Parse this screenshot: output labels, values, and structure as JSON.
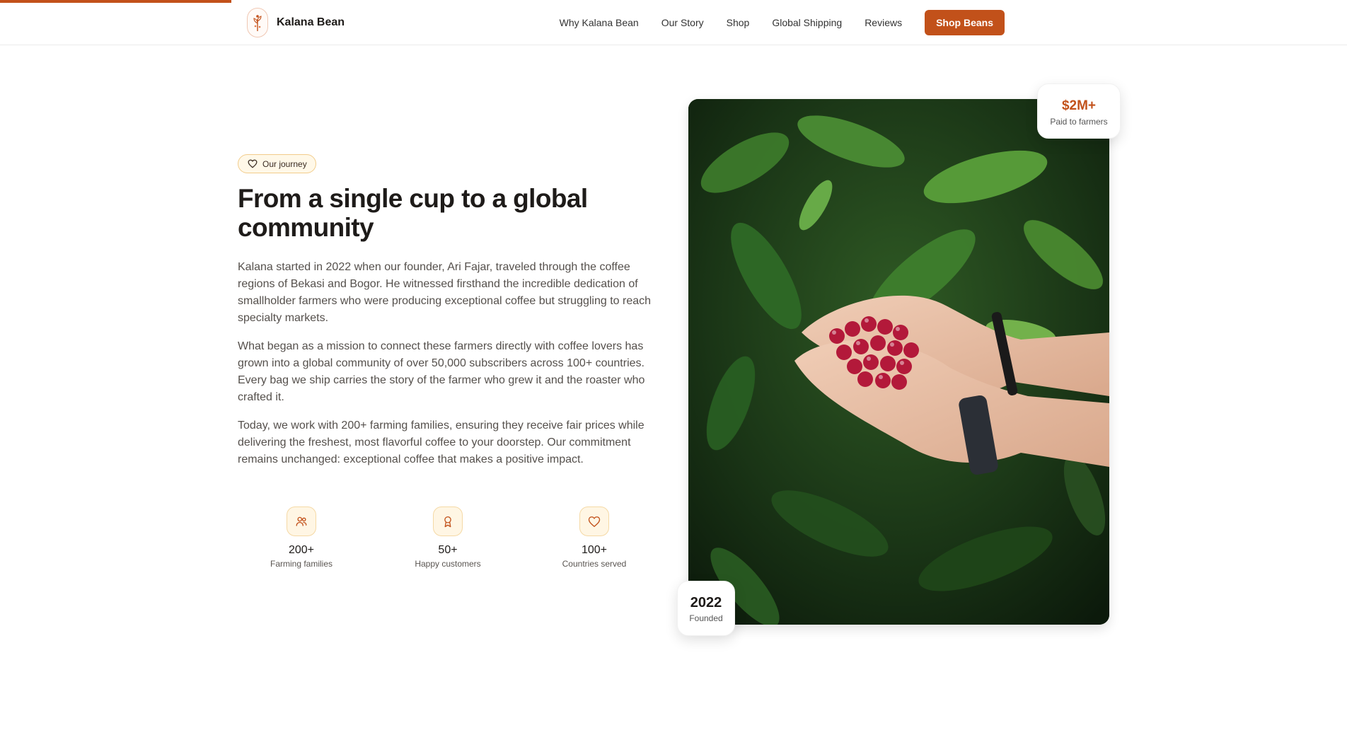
{
  "header": {
    "brand": "Kalana Bean",
    "nav": [
      "Why Kalana Bean",
      "Our Story",
      "Shop",
      "Global Shipping",
      "Reviews"
    ],
    "cta": "Shop Beans"
  },
  "story": {
    "pill": "Our journey",
    "title": "From a single cup to a global community",
    "paragraphs": [
      "Kalana started in 2022 when our founder, Ari Fajar, traveled through the coffee regions of Bekasi and Bogor. He witnessed firsthand the incredible dedication of smallholder farmers who were producing exceptional coffee but struggling to reach specialty markets.",
      "What began as a mission to connect these farmers directly with coffee lovers has grown into a global community of over 50,000 subscribers across 100+ countries. Every bag we ship carries the story of the farmer who grew it and the roaster who crafted it.",
      "Today, we work with 200+ farming families, ensuring they receive fair prices while delivering the freshest, most flavorful coffee to your doorstep. Our commitment remains unchanged: exceptional coffee that makes a positive impact."
    ],
    "stats": [
      {
        "icon": "users-icon",
        "value": "200+",
        "label": "Farming families"
      },
      {
        "icon": "award-icon",
        "value": "50+",
        "label": "Happy customers"
      },
      {
        "icon": "heart-icon",
        "value": "100+",
        "label": "Countries served"
      }
    ]
  },
  "image_badges": {
    "paid": {
      "value": "$2M+",
      "label": "Paid to farmers"
    },
    "founded": {
      "value": "2022",
      "label": "Founded"
    }
  },
  "colors": {
    "accent": "#c2511a",
    "pill_bg": "#fff8e8",
    "pill_border": "#f2cc8b",
    "text_dark": "#1e1b19",
    "text_body": "#55504c"
  }
}
